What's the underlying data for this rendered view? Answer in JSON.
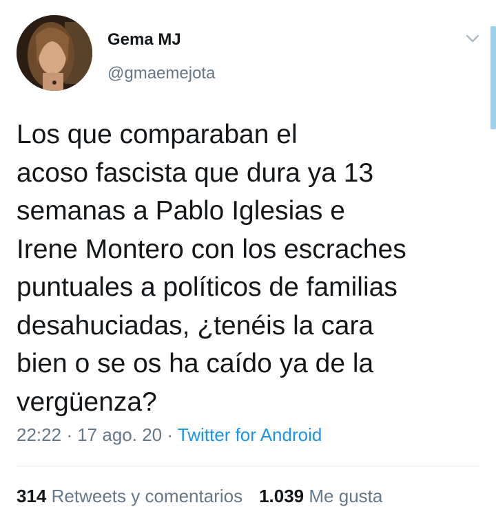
{
  "tweet": {
    "author": {
      "display_name": "Gema MJ",
      "handle": "@gmaemejota"
    },
    "text": "Los que comparaban el\nacoso fascista que dura ya 13\nsemanas a Pablo Iglesias e\nIrene Montero con los escraches\npuntuales a políticos de familias\ndesahuciadas, ¿tenéis la cara\nbien o se os ha caído ya de la\nvergüenza?",
    "time": "22:22",
    "separator": "·",
    "date": "17 ago. 20",
    "source": "Twitter for Android",
    "stats": {
      "retweets_count": "314",
      "retweets_label": "Retweets y comentarios",
      "likes_count": "1.039",
      "likes_label": "Me gusta"
    }
  },
  "icons": {
    "caret": "chevron-down-icon"
  },
  "colors": {
    "text": "#14171a",
    "secondary": "#657786",
    "link": "#1b95e0",
    "divider": "#e1e8ed",
    "scrollbar": "#9fd0f0"
  }
}
